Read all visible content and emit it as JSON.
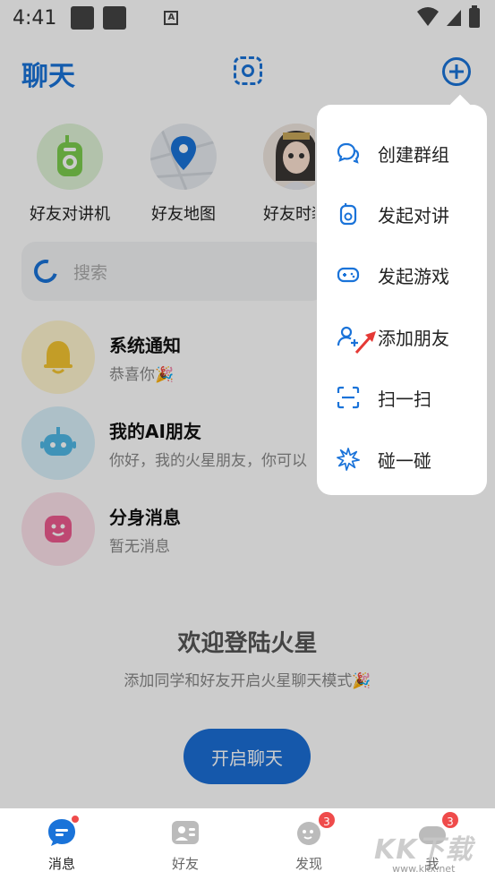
{
  "status_bar": {
    "time": "4:41",
    "a_label": "A"
  },
  "header": {
    "title": "聊天"
  },
  "quick_entries": [
    {
      "label": "好友对讲机"
    },
    {
      "label": "好友地图"
    },
    {
      "label": "好友时装"
    }
  ],
  "search": {
    "placeholder": "搜索"
  },
  "conversations": [
    {
      "name": "系统通知",
      "preview": "恭喜你🎉"
    },
    {
      "name": "我的AI朋友",
      "preview": "你好，我的火星朋友，你可以"
    },
    {
      "name": "分身消息",
      "preview": "暂无消息"
    }
  ],
  "welcome": {
    "title": "欢迎登陆火星",
    "subtitle": "添加同学和好友开启火星聊天模式🎉",
    "button": "开启聊天"
  },
  "menu": {
    "items": [
      {
        "label": "创建群组",
        "icon": "group-chat-icon"
      },
      {
        "label": "发起对讲",
        "icon": "walkie-talkie-icon"
      },
      {
        "label": "发起游戏",
        "icon": "gamepad-icon"
      },
      {
        "label": "添加朋友",
        "icon": "add-friend-icon"
      },
      {
        "label": "扫一扫",
        "icon": "scan-icon"
      },
      {
        "label": "碰一碰",
        "icon": "bump-icon"
      }
    ]
  },
  "bottom_nav": {
    "items": [
      {
        "label": "消息",
        "active": true,
        "badge": ""
      },
      {
        "label": "好友",
        "active": false,
        "badge": ""
      },
      {
        "label": "发现",
        "active": false,
        "badge": "3"
      },
      {
        "label": "我",
        "active": false,
        "badge": "3"
      }
    ]
  },
  "watermark": {
    "main": "KK下载",
    "sub": "www.kkx.net"
  },
  "colors": {
    "accent": "#1a73d9",
    "badge": "#ef4b4b",
    "overlay": "rgba(0,0,0,0.2)"
  }
}
